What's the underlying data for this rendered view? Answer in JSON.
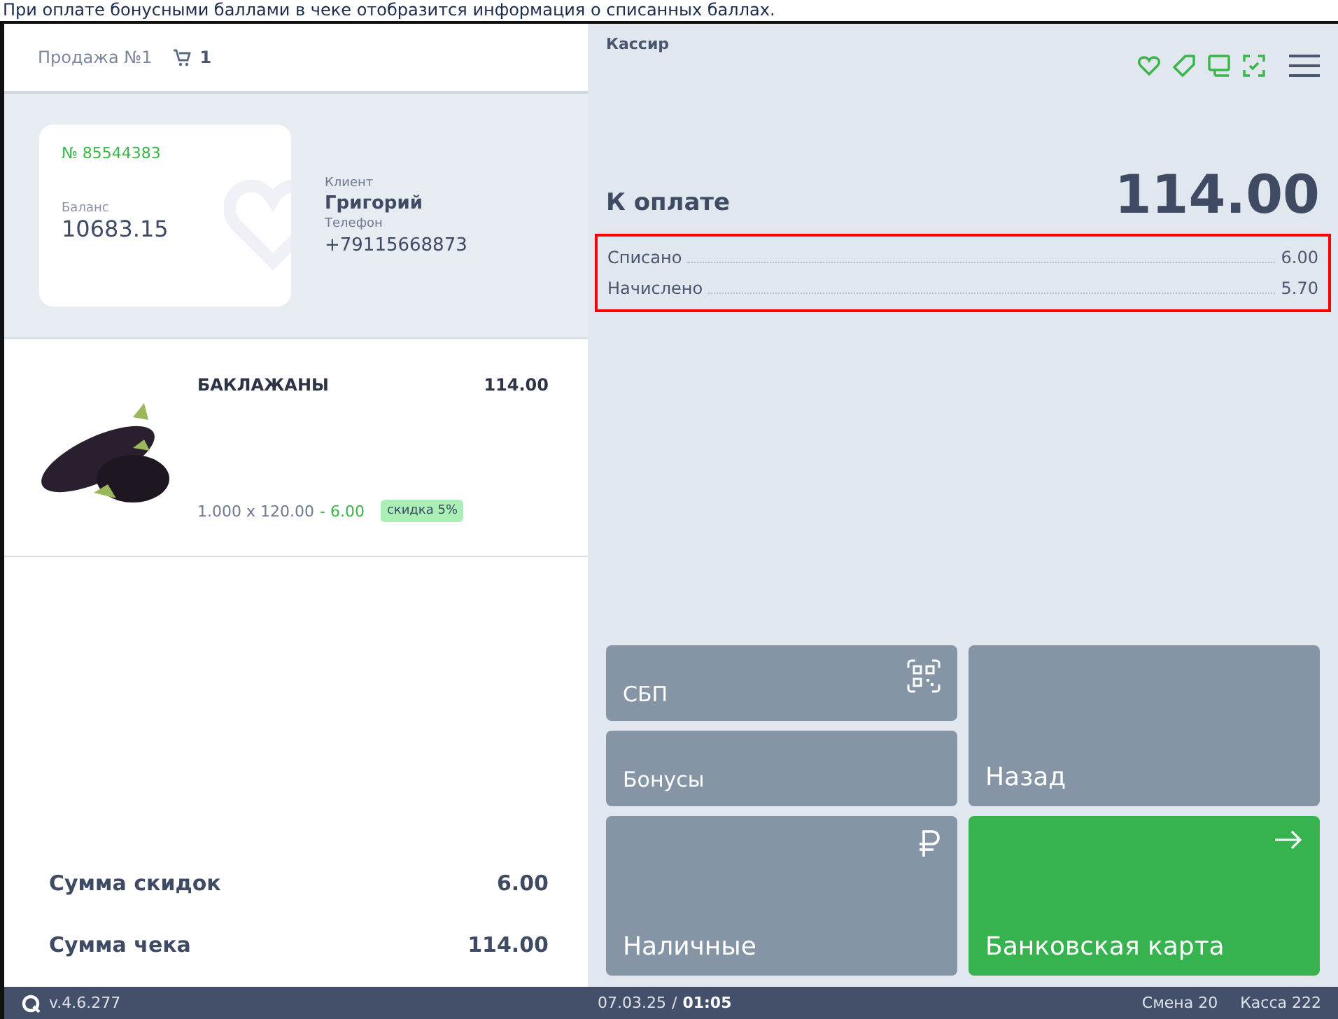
{
  "caption": "При оплате бонусными баллами в чеке отобразится информация о списанных баллах.",
  "sale": {
    "title": "Продажа №1",
    "cart_count": "1"
  },
  "client_card": {
    "number": "№ 85544383",
    "balance_label": "Баланс",
    "balance": "10683.15"
  },
  "client": {
    "client_label": "Клиент",
    "name": "Григорий",
    "phone_label": "Телефон",
    "phone": "+79115668873"
  },
  "items": [
    {
      "name": "БАКЛАЖАНЫ",
      "total": "114.00",
      "qty_price": "1.000 x 120.00",
      "discount": "- 6.00",
      "discount_tag": "скидка 5%"
    }
  ],
  "totals": [
    {
      "label": "Сумма скидок",
      "value": "6.00"
    },
    {
      "label": "Сумма чека",
      "value": "114.00"
    }
  ],
  "cashier": "Кассир",
  "payment": {
    "label": "К оплате",
    "amount": "114.00"
  },
  "bonus_rows": [
    {
      "label": "Списано",
      "value": "6.00"
    },
    {
      "label": "Начислено",
      "value": "5.70"
    }
  ],
  "highlighted": true,
  "buttons": [
    {
      "label": "СБП",
      "kind": "gray"
    },
    {
      "label": "Бонусы",
      "kind": "gray"
    },
    {
      "label": "Назад",
      "kind": "gray"
    },
    {
      "label": "Наличные",
      "kind": "gray"
    },
    {
      "label": "Банковская карта",
      "kind": "green"
    }
  ],
  "status_bar": {
    "version": "v.4.6.277",
    "date": "07.03.25",
    "separator": "/",
    "time": "01:05",
    "shift": "Смена 20",
    "register": "Касса 222"
  }
}
